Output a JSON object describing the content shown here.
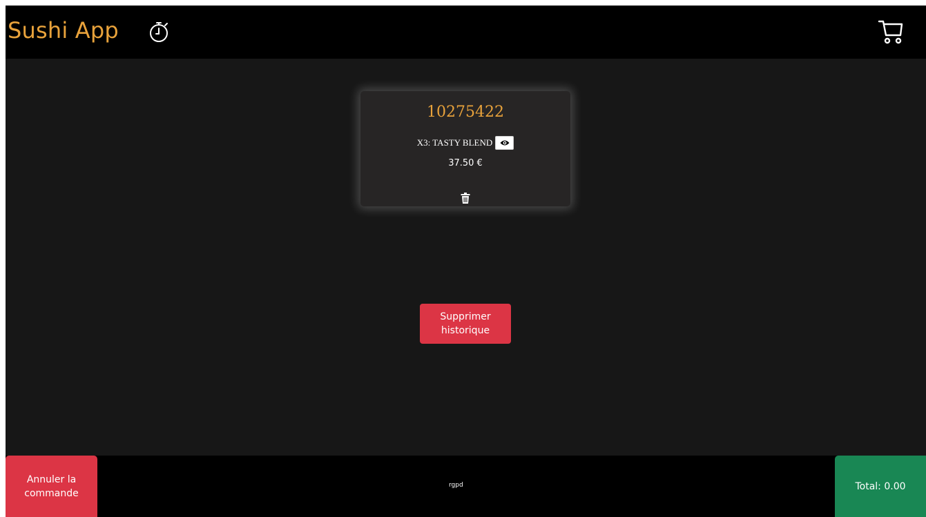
{
  "header": {
    "brand": "Sushi App",
    "timer_icon": "stopwatch-icon",
    "cart_icon": "cart-icon"
  },
  "order_card": {
    "order_id": "10275422",
    "item_label": "X3: TASTY BLEND",
    "view_icon": "eye-icon",
    "price": "37.50 €",
    "delete_icon": "trash-icon"
  },
  "main": {
    "delete_history_label": "Supprimer historique"
  },
  "footer": {
    "cancel_label": "Annuler la commande",
    "rgpd_label": "rgpd",
    "total_label": "Total: 0.00"
  },
  "colors": {
    "accent": "#e8a23b",
    "danger": "#dc3545",
    "success": "#198754",
    "background": "#171717",
    "bar": "#000000",
    "card": "#272525"
  }
}
